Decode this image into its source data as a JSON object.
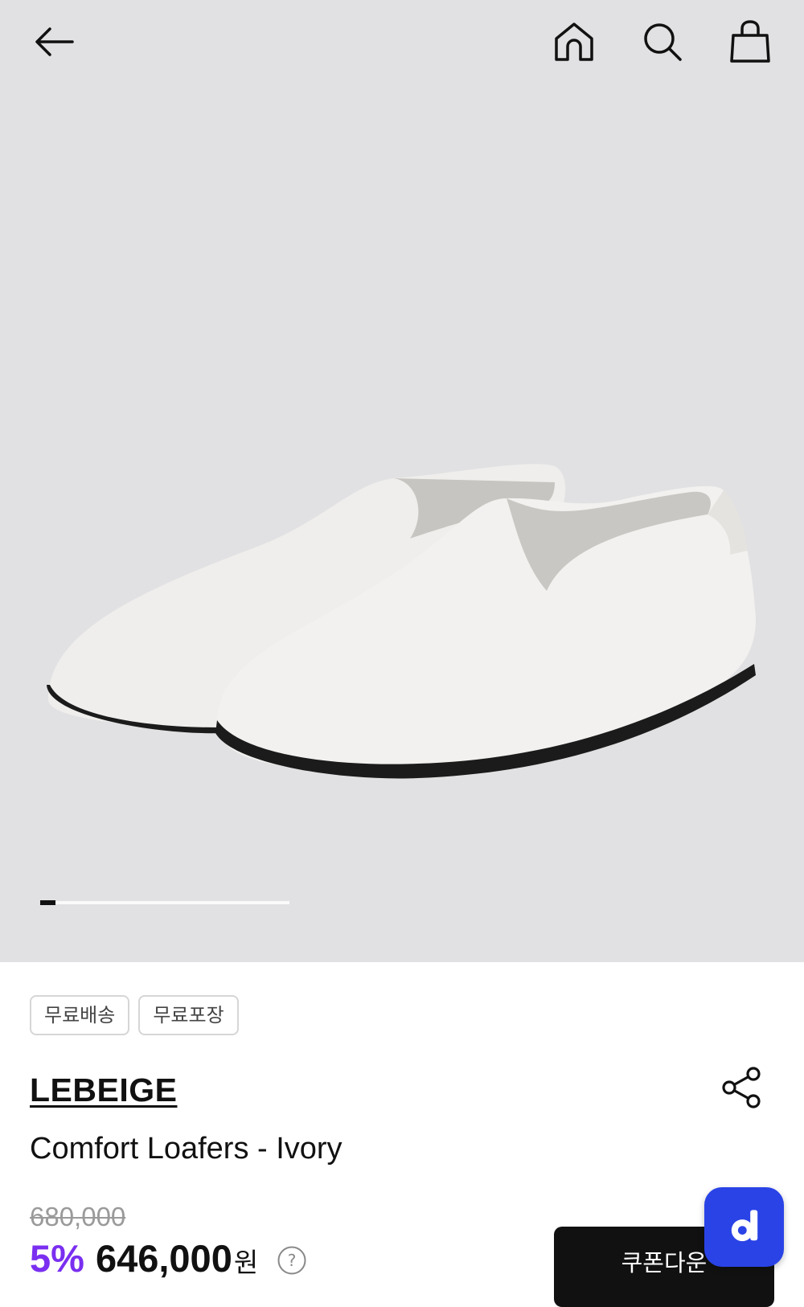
{
  "header": {
    "back_icon": "arrow-left-icon",
    "home_icon": "home-icon",
    "search_icon": "search-icon",
    "cart_icon": "shopping-bag-icon"
  },
  "gallery": {
    "image_alt": "white leather slip-on loafers",
    "progress": 0.06
  },
  "product": {
    "badges": [
      "무료배송",
      "무료포장"
    ],
    "brand": "LEBEIGE",
    "name": "Comfort Loafers - Ivory",
    "original_price": "680,000",
    "discount": "5%",
    "sale_price": "646,000",
    "currency": "원",
    "help_icon": "question-circle-icon",
    "share_icon": "share-icon"
  },
  "actions": {
    "coupon_label": "쿠폰다운",
    "fab_label": "d"
  },
  "colors": {
    "hero_bg": "#e1e1e3",
    "accent_purple": "#7a2ff0",
    "fab_blue": "#2a43e6"
  }
}
